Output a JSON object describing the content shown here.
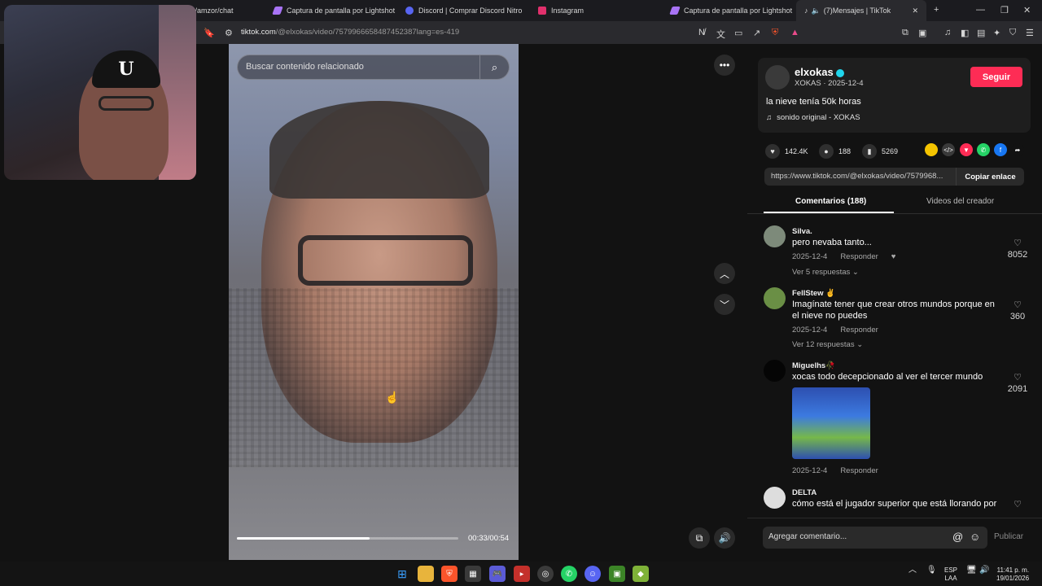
{
  "tabs": [
    {
      "label": "ut/amzor/chat",
      "color": ""
    },
    {
      "label": "Captura de pantalla por Lightshot",
      "color": "#a873f5"
    },
    {
      "label": "Discord | Comprar Discord Nitro",
      "color": "#5865f2"
    },
    {
      "label": "Instagram",
      "color": "#e1306c"
    },
    {
      "label": "Captura de pantalla por Lightshot",
      "color": "#a873f5"
    },
    {
      "label": "(7)Mensajes | TikTok",
      "color": "#ffffff"
    }
  ],
  "address": {
    "domain": "tiktok.com",
    "path": "/@elxokas/video/7579966658487452387lang=es-419"
  },
  "search": {
    "placeholder": "Buscar contenido relacionado"
  },
  "video": {
    "time": "00:33/00:54",
    "progress": 0.6
  },
  "author": {
    "username": "elxokas",
    "subline": "XOKAS · 2025-12-4",
    "follow": "Seguir",
    "description": "la nieve tenía 50k horas",
    "sound": "sonido original - XOKAS"
  },
  "stats": {
    "likes": "142.4K",
    "comments": "188",
    "saves": "5269"
  },
  "share_colors": [
    "#f5c400",
    "#3a3a3a",
    "#fe2c55",
    "#25d366",
    "#1877f2",
    "#121212"
  ],
  "link": {
    "url": "https://www.tiktok.com/@elxokas/video/7579968...",
    "copy": "Copiar enlace"
  },
  "panel_tabs": {
    "comments": "Comentarios (188)",
    "videos": "Videos del creador"
  },
  "comments": [
    {
      "name": "Silva.",
      "text": "pero nevaba tanto...",
      "date": "2025-12-4",
      "reply": "Responder",
      "more": "Ver 5 respuestas ⌄",
      "likes": "8052"
    },
    {
      "name": "FellStew ✌",
      "text1": "Imagínate tener que crear otros mundos porque en",
      "text2": "el nieve no puedes",
      "date": "2025-12-4",
      "reply": "Responder",
      "more": "Ver 12 respuestas ⌄",
      "likes": "360"
    },
    {
      "name": "Miguelhs🥀",
      "text": "xocas todo decepcionado al ver el tercer mundo",
      "date": "2025-12-4",
      "reply": "Responder",
      "likes": "2091"
    },
    {
      "name": "DELTA",
      "text": "cómo está el jugador superior que está llorando por"
    }
  ],
  "composer": {
    "placeholder": "Agregar comentario...",
    "publish": "Publicar"
  },
  "tray": {
    "lang1": "ESP",
    "lang2": "LAA",
    "time": "11:41 p. m.",
    "date": "19/01/2026"
  },
  "webcam_logo": "U"
}
